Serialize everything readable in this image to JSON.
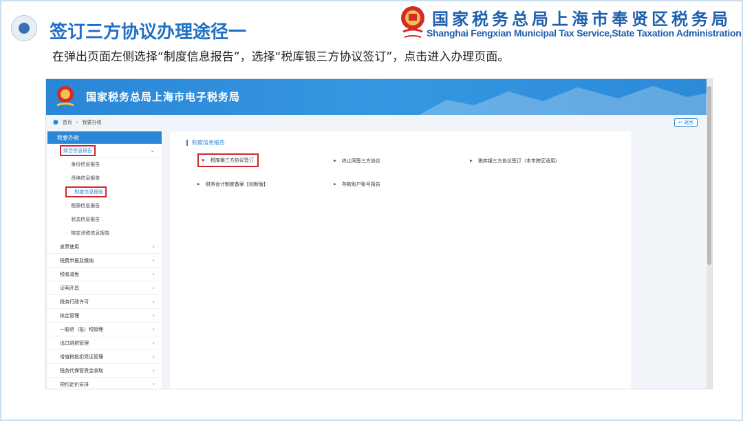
{
  "slide": {
    "title": "签订三方协议办理途径一",
    "subtitle": "在弹出页面左侧选择“制度信息报告”，选择“税库银三方协议签订”，点击进入办理页面。",
    "bureau_cn": "国家税务总局上海市奉贤区税务局",
    "bureau_en": "Shanghai Fengxian Municipal Tax Service,State Taxation Administration",
    "logo_icon": "tax-emblem-icon"
  },
  "site": {
    "title": "国家税务总局上海市电子税务局",
    "breadcrumb": [
      "首页",
      "我要办税"
    ],
    "back_label": "返回"
  },
  "sidebar": {
    "header": "我要办税",
    "group_open": "综合信息报告",
    "sub_items": [
      "身份信息报告",
      "资格信息报告",
      "制度信息报告",
      "税源信息报告",
      "状态信息报告",
      "特定涉税信息报告"
    ],
    "active_sub_index": 2,
    "items": [
      "发票使用",
      "税费申报及缴纳",
      "税收减免",
      "证明开具",
      "税务行政许可",
      "核定管理",
      "一般退（抵）税管理",
      "出口退税管理",
      "增值税抵扣凭证管理",
      "税务代保管资金收取",
      "预约定价安排"
    ]
  },
  "panel": {
    "title": "制度信息报告",
    "items": [
      "税库银三方协议签订",
      "终止网签三方协议",
      "税库银三方协议签订（本市跨区适用）",
      "财务会计制度备案【创新版】",
      "存款账户账号报告"
    ]
  },
  "colors": {
    "accent": "#1f6fc6",
    "header_blue": "#2a86d6",
    "highlight_red": "#d3242c"
  }
}
